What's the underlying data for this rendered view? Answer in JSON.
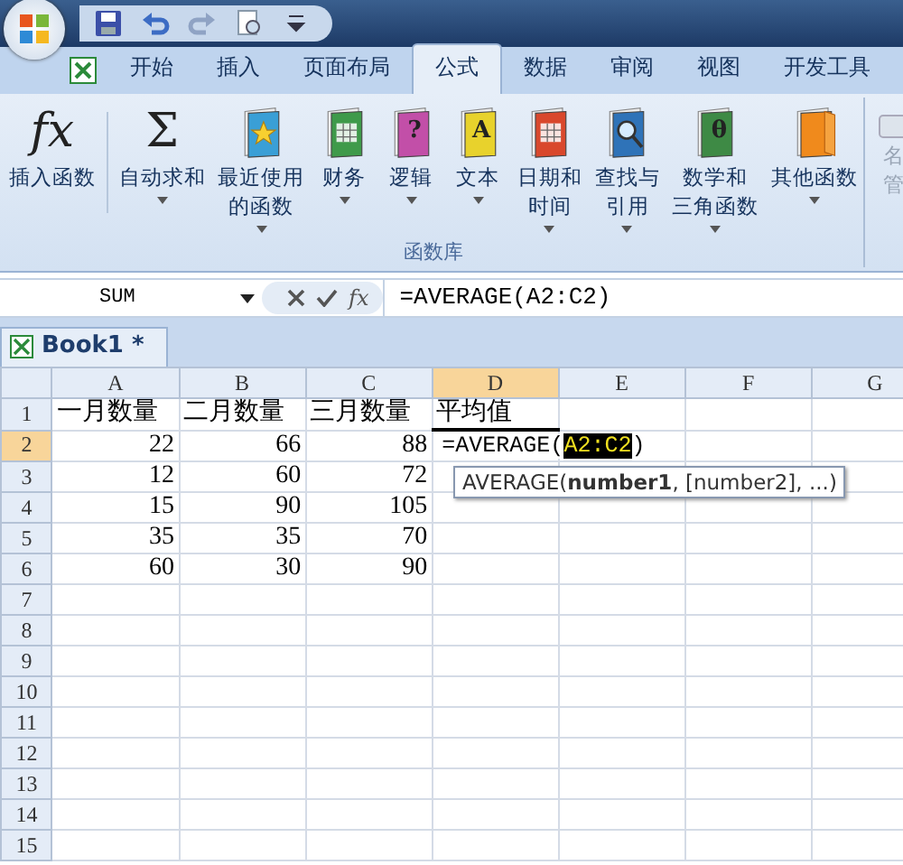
{
  "tabs": [
    {
      "label": "开始",
      "selected": false
    },
    {
      "label": "插入",
      "selected": false
    },
    {
      "label": "页面布局",
      "selected": false
    },
    {
      "label": "公式",
      "selected": true
    },
    {
      "label": "数据",
      "selected": false
    },
    {
      "label": "审阅",
      "selected": false
    },
    {
      "label": "视图",
      "selected": false
    },
    {
      "label": "开发工具",
      "selected": false
    }
  ],
  "ribbon": {
    "group_label": "函数库",
    "buttons": [
      {
        "kind": "glyph",
        "glyph": "fx",
        "lines": [
          "插入函数"
        ],
        "dropdown": false
      },
      {
        "kind": "glyph",
        "glyph": "Σ",
        "lines": [
          "自动求和"
        ],
        "dropdown": true
      },
      {
        "kind": "star",
        "color": "#3a9fd6",
        "lines": [
          "最近使用",
          "的函数"
        ],
        "dropdown": true
      },
      {
        "kind": "grid",
        "color": "#3f9a4a",
        "lines": [
          "财务"
        ],
        "dropdown": true
      },
      {
        "kind": "letter",
        "color": "#c24fa8",
        "glyph": "?",
        "lines": [
          "逻辑"
        ],
        "dropdown": true
      },
      {
        "kind": "letter",
        "color": "#e8d22c",
        "glyph": "A",
        "lines": [
          "文本"
        ],
        "dropdown": true
      },
      {
        "kind": "grid",
        "color": "#d9482c",
        "lines": [
          "日期和",
          "时间"
        ],
        "dropdown": true
      },
      {
        "kind": "lens",
        "color": "#2f73b8",
        "lines": [
          "查找与",
          "引用"
        ],
        "dropdown": true
      },
      {
        "kind": "letter",
        "color": "#3e8a45",
        "glyph": "θ",
        "lines": [
          "数学和",
          "三角函数"
        ],
        "dropdown": true
      },
      {
        "kind": "stack",
        "color": "#f08a1c",
        "lines": [
          "其他函数"
        ],
        "dropdown": true
      }
    ],
    "partial_lines": [
      "名",
      "管"
    ]
  },
  "name_box": "SUM",
  "insert_function_label": "fx",
  "formula": "=AVERAGE(A2:C2)",
  "workbook_tab": "Book1 *",
  "columns": [
    {
      "label": "A",
      "selected": false
    },
    {
      "label": "B",
      "selected": false
    },
    {
      "label": "C",
      "selected": false
    },
    {
      "label": "D",
      "selected": true
    },
    {
      "label": "E",
      "selected": false
    },
    {
      "label": "F",
      "selected": false
    },
    {
      "label": "G",
      "selected": false
    }
  ],
  "rows": [
    {
      "header": "1",
      "kind": "text",
      "cells": [
        "一月数量",
        "二月数量",
        "三月数量",
        "平均值"
      ]
    },
    {
      "header": "2",
      "kind": "number",
      "cells": [
        "22",
        "66",
        "88"
      ],
      "marked": true,
      "editing": {
        "before": "=AVERAGE(",
        "ref": "A2:C2",
        "after": ")"
      }
    },
    {
      "header": "3",
      "kind": "number",
      "cells": [
        "12",
        "60",
        "72"
      ]
    },
    {
      "header": "4",
      "kind": "number",
      "cells": [
        "15",
        "90",
        "105"
      ]
    },
    {
      "header": "5",
      "kind": "number",
      "cells": [
        "35",
        "35",
        "70"
      ]
    },
    {
      "header": "6",
      "kind": "number",
      "cells": [
        "60",
        "30",
        "90"
      ]
    },
    {
      "header": "7"
    },
    {
      "header": "8"
    },
    {
      "header": "9"
    },
    {
      "header": "10"
    },
    {
      "header": "11"
    },
    {
      "header": "12"
    },
    {
      "header": "13"
    },
    {
      "header": "14"
    },
    {
      "header": "15"
    }
  ],
  "tooltip": "AVERAGE(**number1**, [number2], ...)"
}
